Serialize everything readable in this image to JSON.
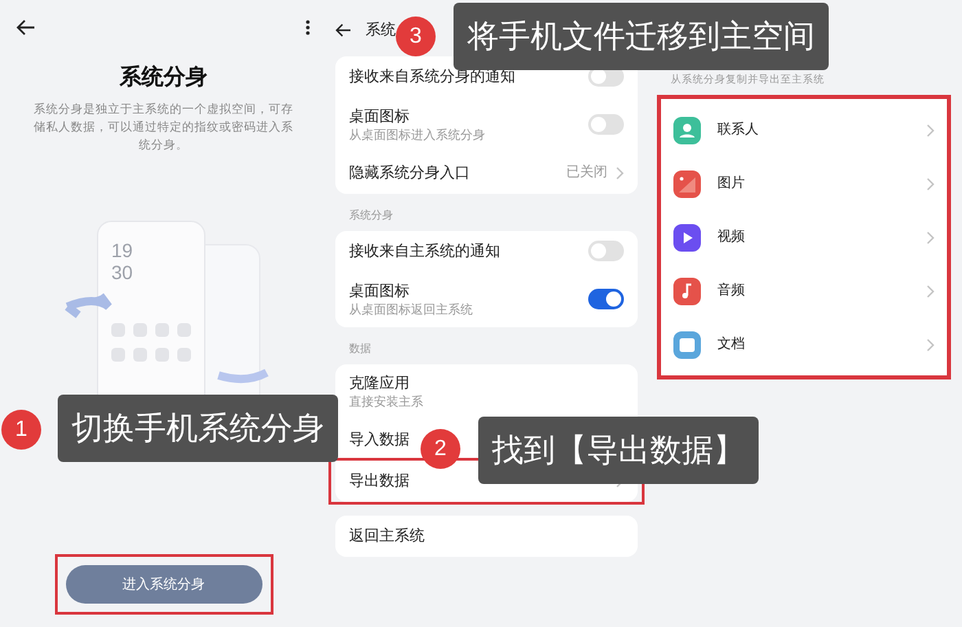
{
  "left_screen": {
    "title": "系统分身",
    "description": "系统分身是独立于主系统的一个虚拟空间，可存储私人数据，可以通过特定的指纹或密码进入系统分身。",
    "illustration_clock": [
      "19",
      "30"
    ],
    "enter_button": {
      "label": "进入系统分身",
      "highlighted": true
    }
  },
  "middle_screen": {
    "header_title": "系统",
    "sections": [
      {
        "rows": [
          {
            "kind": "toggle",
            "label": "接收来自系统分身的通知",
            "on": false
          },
          {
            "kind": "toggle",
            "label": "桌面图标",
            "subtitle": "从桌面图标进入系统分身",
            "on": false
          },
          {
            "kind": "link",
            "label": "隐藏系统分身入口",
            "value": "已关闭",
            "highlighted": false
          }
        ]
      },
      {
        "label": "系统分身",
        "rows": [
          {
            "kind": "toggle",
            "label": "接收来自主系统的通知",
            "on": false
          },
          {
            "kind": "toggle",
            "label": "桌面图标",
            "subtitle": "从桌面图标返回主系统",
            "on": true
          }
        ]
      },
      {
        "label": "数据",
        "rows": [
          {
            "kind": "plain",
            "label": "克隆应用",
            "subtitle": "直接安装主系"
          },
          {
            "kind": "plain",
            "label": "导入数据"
          },
          {
            "kind": "link",
            "label": "导出数据",
            "highlighted": true
          }
        ]
      },
      {
        "rows": [
          {
            "kind": "plain",
            "label": "返回主系统"
          }
        ]
      }
    ]
  },
  "right_screen": {
    "subtitle": "从系统分身复制并导出至主系统",
    "highlighted": true,
    "items": [
      {
        "kind": "contacts",
        "label": "联系人",
        "color": "#3dbf9a"
      },
      {
        "kind": "pictures",
        "label": "图片",
        "color": "#e5524a"
      },
      {
        "kind": "video",
        "label": "视频",
        "color": "#6b4ef0"
      },
      {
        "kind": "audio",
        "label": "音频",
        "color": "#e5524a"
      },
      {
        "kind": "documents",
        "label": "文档",
        "color": "#5aa6dc"
      }
    ]
  },
  "callouts": [
    {
      "number": "3",
      "text": "将手机文件迁移到主空间"
    },
    {
      "number": "1",
      "text": "切换手机系统分身"
    },
    {
      "number": "2",
      "text": "找到【导出数据】"
    }
  ]
}
